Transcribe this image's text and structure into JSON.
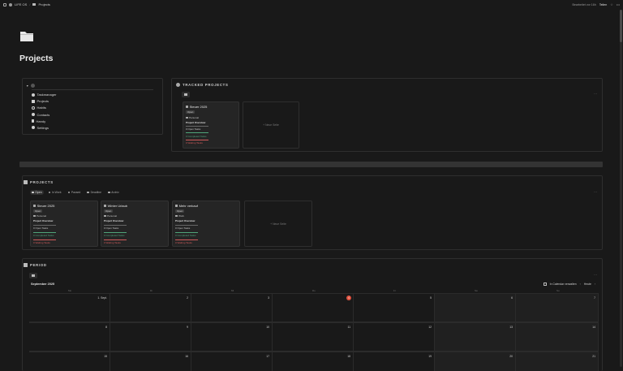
{
  "topbar": {
    "workspace": "LIFE OS",
    "page": "Projects",
    "edited": "Bearbeitet vor 16h",
    "share": "Teilen"
  },
  "page": {
    "title": "Projects"
  },
  "nav": {
    "items": [
      {
        "label": "Taskmanager",
        "icon": "check-circle-icon"
      },
      {
        "label": "Projects",
        "icon": "folder-icon"
      },
      {
        "label": "Habits",
        "icon": "circle-icon"
      },
      {
        "label": "Contacts",
        "icon": "contacts-icon"
      },
      {
        "label": "Handy",
        "icon": "phone-icon"
      },
      {
        "label": "Settings",
        "icon": "gear-icon"
      }
    ]
  },
  "tracked": {
    "heading": "TRACKED PROJECTS",
    "card": {
      "title": "Steuer 2025",
      "status": "Open",
      "area": "Personal",
      "overview": "Project Overview",
      "open_tasks": "0 Open Tasks",
      "completed_tasks": "0 Completed Tasks",
      "waiting_tasks": "0 Waiting Tasks"
    },
    "new_label": "+ Neue Seite"
  },
  "projects": {
    "heading": "PROJECTS",
    "tabs": [
      "Open",
      "In Work",
      "Paused",
      "Deadline",
      "Archiv"
    ],
    "cards": [
      {
        "title": "Steuer 2025",
        "status": "Open",
        "area": "Personal",
        "overview": "Project Overview",
        "open": "0 Open Tasks",
        "completed": "0 Completed Tasks",
        "waiting": "0 Waiting Tasks"
      },
      {
        "title": "Winter Urlaub",
        "status": "Open",
        "area": "Personal",
        "overview": "Project Overview",
        "open": "0 Open Tasks",
        "completed": "0 Completed Tasks",
        "waiting": "0 Waiting Tasks"
      },
      {
        "title": "Mehr verkauf",
        "status": "Open",
        "area": "Work",
        "overview": "Project Overview",
        "open": "0 Open Tasks",
        "completed": "0 Completed Tasks",
        "waiting": "0 Waiting Tasks"
      }
    ],
    "new_label": "+ Neue Seite"
  },
  "period": {
    "heading": "PERIOD",
    "month": "September 2025",
    "open_in_calendar": "In Calendar verwalten",
    "today": "Heute",
    "weekdays": [
      "Mo",
      "Di",
      "Mi",
      "Do",
      "Fr",
      "Sa",
      "So"
    ],
    "row1": [
      "1. Sept.",
      "2",
      "3",
      "4",
      "5",
      "6",
      "7"
    ],
    "row2": [
      "8",
      "9",
      "10",
      "11",
      "12",
      "13",
      "14"
    ],
    "row3": [
      "15",
      "16",
      "17",
      "18",
      "19",
      "20",
      "21"
    ]
  },
  "colors": {
    "background": "#191919",
    "done": "#4fa57a",
    "waiting": "#d05a5a",
    "today": "#e0523f"
  }
}
